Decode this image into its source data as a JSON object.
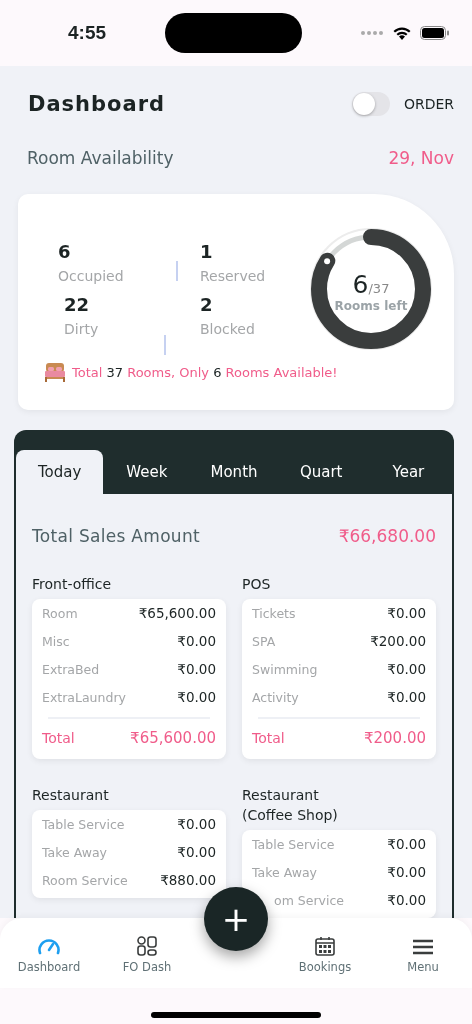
{
  "status_bar": {
    "time": "4:55"
  },
  "header": {
    "title": "Dashboard",
    "order_toggle": {
      "label": "ORDER",
      "on": false
    }
  },
  "room_availability": {
    "title": "Room Availability",
    "date": "29, Nov",
    "stats": [
      {
        "value": "6",
        "label": "Occupied"
      },
      {
        "value": "1",
        "label": "Reserved"
      },
      {
        "value": "22",
        "label": "Dirty"
      },
      {
        "value": "2",
        "label": "Blocked"
      }
    ],
    "gauge": {
      "value": "6",
      "total": "/37",
      "label": "Rooms left",
      "level": 0.84
    },
    "summary": [
      {
        "text": "Total ",
        "kind": "accent"
      },
      {
        "text": "37",
        "kind": "plain"
      },
      {
        "text": " Rooms, Only ",
        "kind": "accent"
      },
      {
        "text": "6",
        "kind": "plain"
      },
      {
        "text": " Rooms Available!",
        "kind": "accent"
      }
    ]
  },
  "sales": {
    "tabs": [
      {
        "label": "Today",
        "selected": true
      },
      {
        "label": "Week",
        "selected": false
      },
      {
        "label": "Month",
        "selected": false
      },
      {
        "label": "Quart",
        "selected": false
      },
      {
        "label": "Year",
        "selected": false
      }
    ],
    "total_label": "Total Sales Amount",
    "total_amount": "₹66,680.00",
    "sections": [
      {
        "title": "Front-office",
        "rows": [
          {
            "label": "Room",
            "value": "₹65,600.00"
          },
          {
            "label": "Misc",
            "value": "₹0.00"
          },
          {
            "label": "ExtraBed",
            "value": "₹0.00"
          },
          {
            "label": "ExtraLaundry",
            "value": "₹0.00"
          }
        ],
        "total": {
          "label": "Total",
          "value": "₹65,600.00"
        }
      },
      {
        "title": "POS",
        "rows": [
          {
            "label": "Tickets",
            "value": "₹0.00"
          },
          {
            "label": "SPA",
            "value": "₹200.00"
          },
          {
            "label": "Swimming",
            "value": "₹0.00"
          },
          {
            "label": "Activity",
            "value": "₹0.00"
          }
        ],
        "total": {
          "label": "Total",
          "value": "₹200.00"
        }
      },
      {
        "title": "Restaurant",
        "rows": [
          {
            "label": "Table Service",
            "value": "₹0.00"
          },
          {
            "label": "Take Away",
            "value": "₹0.00"
          },
          {
            "label": "Room Service",
            "value": "₹880.00"
          }
        ]
      },
      {
        "title": "Restaurant (Coffee Shop)",
        "rows": [
          {
            "label": "Table Service",
            "value": "₹0.00"
          },
          {
            "label": "Take Away",
            "value": "₹0.00"
          },
          {
            "label": "om Service",
            "value": "₹0.00"
          }
        ]
      }
    ]
  },
  "add_button": {
    "label": "+"
  },
  "bottom_nav": [
    {
      "label": "Dashboard",
      "kind": "gauge",
      "selected": true
    },
    {
      "label": "FO Dash",
      "kind": "grid",
      "selected": false
    },
    {
      "label": "Bookings",
      "kind": "calendar",
      "selected": false
    },
    {
      "label": "Menu",
      "kind": "menu",
      "selected": false
    }
  ]
}
